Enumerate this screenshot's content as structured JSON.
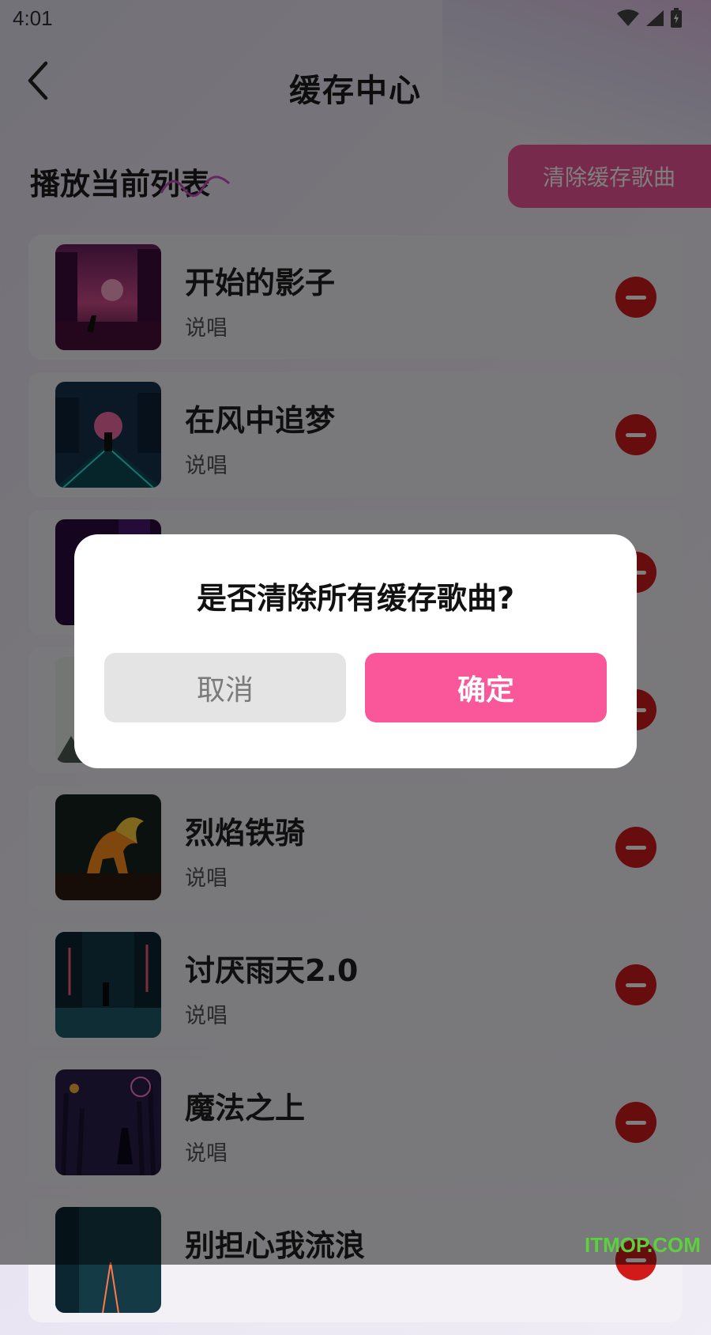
{
  "status_bar": {
    "time": "4:01"
  },
  "header": {
    "title": "缓存中心"
  },
  "section": {
    "title": "播放当前列表",
    "clear_button": "清除缓存歌曲"
  },
  "songs": [
    {
      "name": "开始的影子",
      "genre": "说唱",
      "cover_icon": "city-runner-cover"
    },
    {
      "name": "在风中追梦",
      "genre": "说唱",
      "cover_icon": "future-road-cover"
    },
    {
      "name": "",
      "genre": "",
      "cover_icon": "neon-city-cover"
    },
    {
      "name": "",
      "genre": "",
      "cover_icon": "misty-cover"
    },
    {
      "name": "烈焰铁骑",
      "genre": "说唱",
      "cover_icon": "fire-horse-cover"
    },
    {
      "name": "讨厌雨天2.0",
      "genre": "说唱",
      "cover_icon": "rainy-street-cover"
    },
    {
      "name": "魔法之上",
      "genre": "说唱",
      "cover_icon": "magic-forest-cover"
    },
    {
      "name": "别担心我流浪",
      "genre": "",
      "cover_icon": "night-city-cover"
    }
  ],
  "dialog": {
    "message": "是否清除所有缓存歌曲?",
    "cancel": "取消",
    "confirm": "确定"
  },
  "watermark": "ITMOP.COM",
  "colors": {
    "accent": "#f9579a",
    "remove": "#d11b1b"
  }
}
